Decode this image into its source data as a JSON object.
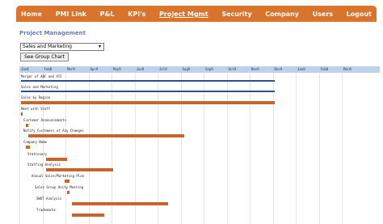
{
  "nav": {
    "items": [
      {
        "label": "Home",
        "active": false
      },
      {
        "label": "PMI Link",
        "active": false
      },
      {
        "label": "P&L",
        "active": false
      },
      {
        "label": "KPI's",
        "active": false
      },
      {
        "label": "Project Mgmt",
        "active": true
      },
      {
        "label": "Security",
        "active": false
      },
      {
        "label": "Company",
        "active": false
      },
      {
        "label": "Users",
        "active": false
      },
      {
        "label": "Logout",
        "active": false
      }
    ],
    "color": "#d8742c"
  },
  "page_title": "Project Management",
  "group_select": {
    "value": "Sales and Marketing"
  },
  "chart_button": {
    "label": "See Group Chart"
  },
  "gantt": {
    "months": [
      "Jan8",
      "Feb8",
      "Mar9",
      "Apr9",
      "May9",
      "Jun9",
      "Jul9",
      "Aug9",
      "Sep9",
      "Oct9",
      "Nov9",
      "Dec9",
      "Jan0",
      "Feb0",
      "Mar0"
    ],
    "tasks": [
      {
        "label": "Merger of ABC and XYZ",
        "start": 0,
        "end": 11,
        "kind": "summary"
      },
      {
        "label": "Sales and Marketing",
        "start": 0,
        "end": 11,
        "kind": "summary"
      },
      {
        "label": "Sales by Region",
        "start": 0,
        "end": 11,
        "kind": "task"
      },
      {
        "label": "Meet with Staff",
        "start": 0,
        "end": 0.05,
        "kind": "task"
      },
      {
        "label": "Customer Announcements",
        "start": 0.2,
        "end": 0.3,
        "kind": "task"
      },
      {
        "label": "Notify Customers of Any Changes",
        "start": 0.3,
        "end": 7.1,
        "kind": "task"
      },
      {
        "label": "Company Name",
        "start": 0.2,
        "end": 0.4,
        "kind": "task"
      },
      {
        "label": "Stationary",
        "start": 1.1,
        "end": 2.0,
        "kind": "task"
      },
      {
        "label": "Staffing Analysis",
        "start": 1.1,
        "end": 4.0,
        "kind": "task"
      },
      {
        "label": "Annual Sales/Marketing Plan",
        "start": 1.9,
        "end": 2.1,
        "kind": "task"
      },
      {
        "label": "Sales Group Unity Meeting",
        "start": 2.0,
        "end": 2.1,
        "kind": "task"
      },
      {
        "label": "SWOT Analysis",
        "start": 2.2,
        "end": 6.4,
        "kind": "task"
      },
      {
        "label": "Trademarks",
        "start": 2.2,
        "end": 3.6,
        "kind": "task"
      }
    ],
    "summary_color": "#2f4f8a",
    "task_color": "#c9652c",
    "header_color": "#bcd2ec"
  }
}
